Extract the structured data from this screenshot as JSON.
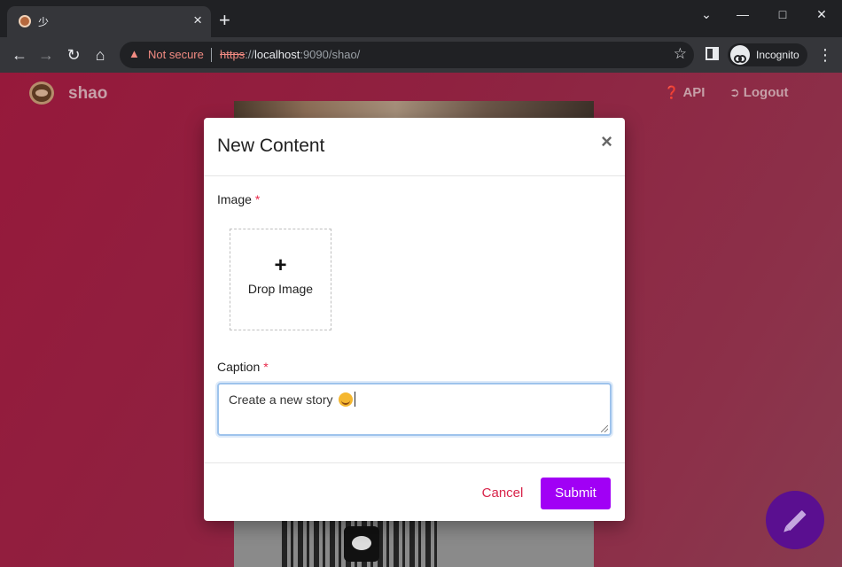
{
  "browser": {
    "tab_title": "少",
    "tab_close": "×",
    "new_tab": "+",
    "omnibox": {
      "security_label": "Not secure",
      "url_scheme": "https",
      "url_sep": "://",
      "url_host": "localhost",
      "url_rest": ":9090/shao/"
    },
    "profile_label": "Incognito"
  },
  "app": {
    "brand": "shao",
    "nav": {
      "api_label": "API",
      "logout_label": "Logout"
    }
  },
  "modal": {
    "title": "New Content",
    "close_glyph": "×",
    "image_label": "Image",
    "required_mark": "*",
    "dropzone": {
      "plus": "+",
      "label": "Drop Image"
    },
    "caption_label": "Caption",
    "caption_value": "Create a new story",
    "cancel_label": "Cancel",
    "submit_label": "Submit"
  },
  "colors": {
    "accent": "#a100f5",
    "danger": "#d8244a",
    "fab": "#5a0f90"
  }
}
